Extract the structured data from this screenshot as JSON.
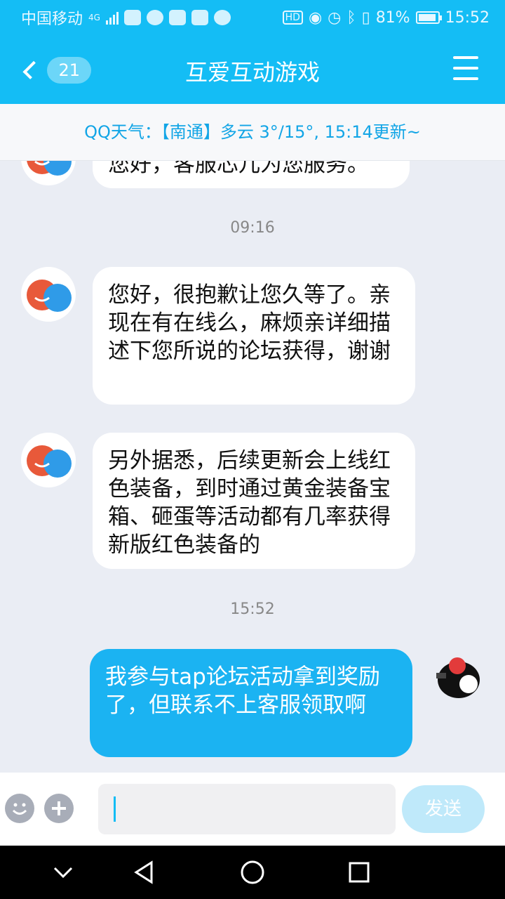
{
  "status_bar": {
    "carrier": "中国移动",
    "network": "4G",
    "battery": "81%",
    "time": "15:52",
    "hd": "HD"
  },
  "header": {
    "unread_count": "21",
    "title": "互爱互动游戏"
  },
  "weather": {
    "text": "QQ天气：【南通】多云 3°/15°, 15:14更新~"
  },
  "chat": {
    "partial_message": "您好，客服芯儿为您服务。",
    "time1": "09:16",
    "msg1": "您好，很抱歉让您久等了。亲现在有在线么，麻烦亲详细描述下您所说的论坛获得，谢谢",
    "msg2": "另外据悉，后续更新会上线红色装备，到时通过黄金装备宝箱、砸蛋等活动都有几率获得新版红色装备的",
    "time2": "15:52",
    "msg3": "我参与tap论坛活动拿到奖励了，但联系不上客服领取啊"
  },
  "input": {
    "send_label": "发送"
  },
  "colors": {
    "brand": "#14bdf5",
    "my_bubble": "#1bb3f2",
    "weather_text": "#12a5e6"
  }
}
